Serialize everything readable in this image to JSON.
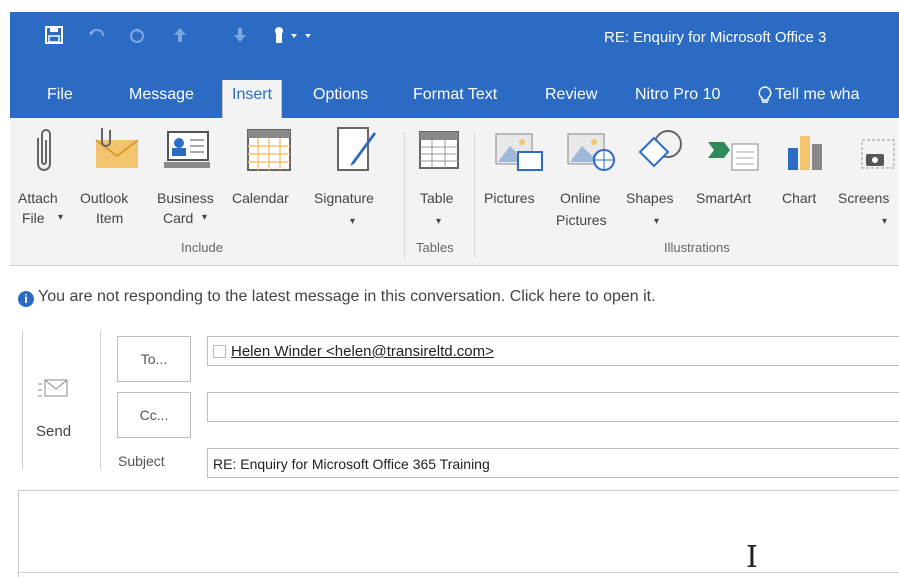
{
  "window": {
    "title": "RE: Enquiry for Microsoft Office 3"
  },
  "ribbon": {
    "tabs": [
      {
        "label": "File"
      },
      {
        "label": "Message"
      },
      {
        "label": "Insert"
      },
      {
        "label": "Options"
      },
      {
        "label": "Format Text"
      },
      {
        "label": "Review"
      },
      {
        "label": "Nitro Pro 10"
      },
      {
        "label": "Tell me wha"
      }
    ],
    "buttons": {
      "attach_file": {
        "line1": "Attach",
        "line2": "File"
      },
      "outlook_item": {
        "line1": "Outlook",
        "line2": "Item"
      },
      "business_card": {
        "line1": "Business",
        "line2": "Card"
      },
      "calendar": {
        "line1": "Calendar"
      },
      "signature": {
        "line1": "Signature"
      },
      "table": {
        "line1": "Table"
      },
      "pictures": {
        "line1": "Pictures"
      },
      "online_pictures": {
        "line1": "Online",
        "line2": "Pictures"
      },
      "shapes": {
        "line1": "Shapes"
      },
      "smartart": {
        "line1": "SmartArt"
      },
      "chart": {
        "line1": "Chart"
      },
      "screenshot": {
        "line1": "Screens"
      }
    },
    "groups": {
      "include": "Include",
      "tables": "Tables",
      "illustrations": "Illustrations"
    }
  },
  "infobar": {
    "message": "You are not responding to the latest message in this conversation. Click here to open it."
  },
  "compose": {
    "send_label": "Send",
    "to_label": "To...",
    "cc_label": "Cc...",
    "subject_label": "Subject",
    "to_value": "Helen Winder <helen@transireltd.com>",
    "cc_value": "",
    "subject_value": "RE: Enquiry for Microsoft Office 365 Training"
  },
  "colors": {
    "accent": "#2b6bc4",
    "ribbon_bg": "#f3f3f3"
  },
  "icons": [
    "save-icon",
    "undo-icon",
    "redo-icon",
    "up-arrow-icon",
    "down-arrow-icon",
    "touch-mode-icon",
    "paperclip-icon",
    "envelope-icon",
    "business-card-icon",
    "calendar-icon",
    "signature-icon",
    "table-icon",
    "pictures-icon",
    "online-pictures-icon",
    "shapes-icon",
    "smartart-icon",
    "chart-icon",
    "screenshot-icon",
    "info-icon",
    "send-icon",
    "text-cursor-icon",
    "lightbulb-icon"
  ]
}
